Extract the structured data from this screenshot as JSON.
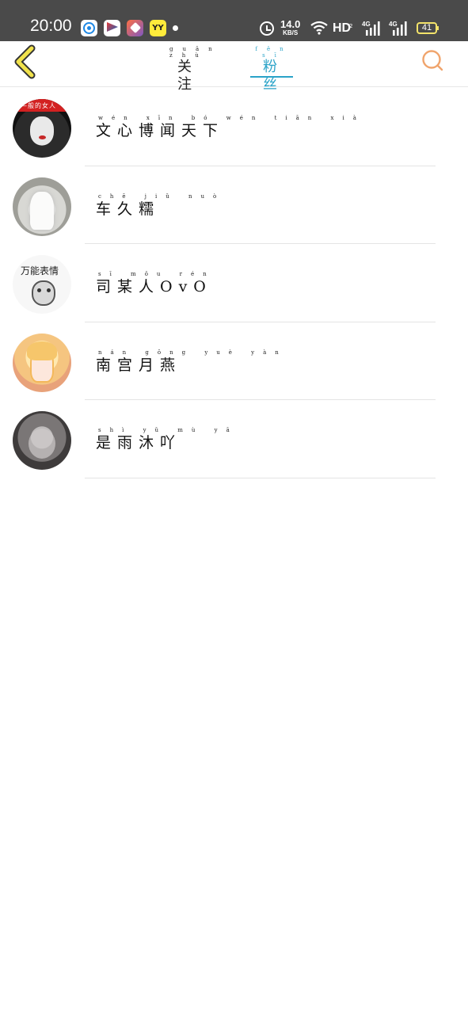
{
  "status_bar": {
    "time": "20:00",
    "app_icons": [
      "browser-app-icon",
      "video-app-icon",
      "shortcut-app-icon",
      "yy-app-icon"
    ],
    "yy_label": "YY",
    "net_speed_value": "14.0",
    "net_speed_unit": "KB/S",
    "hd_label": "HD",
    "hd_sub": "2",
    "signal_1_label": "4G",
    "signal_2_label": "4G",
    "battery_level": "41"
  },
  "header": {
    "tabs": [
      {
        "pinyin": "guān zhù",
        "label": "关注",
        "active": false
      },
      {
        "pinyin": "fěn sī",
        "label": "粉丝",
        "active": true
      }
    ],
    "accent_color": "#2aa3c8",
    "back_icon_color": "#f1e24c",
    "search_icon_color": "#f0a46c"
  },
  "fans": [
    {
      "pinyin": "wén xīn bó wén tiān xià",
      "name": "文心博闻天下",
      "avatar_caption": "—般的女人"
    },
    {
      "pinyin": "chē jiǔ nuò",
      "name": "车久糯",
      "avatar_caption": ""
    },
    {
      "pinyin": "sī mǒu rén",
      "name": "司某人OvO",
      "avatar_caption": "万能表情"
    },
    {
      "pinyin": "nán gōng yuè yàn",
      "name": "南宫月燕",
      "avatar_caption": ""
    },
    {
      "pinyin": "shì yǔ mù yā",
      "name": "是雨沐吖",
      "avatar_caption": ""
    }
  ]
}
